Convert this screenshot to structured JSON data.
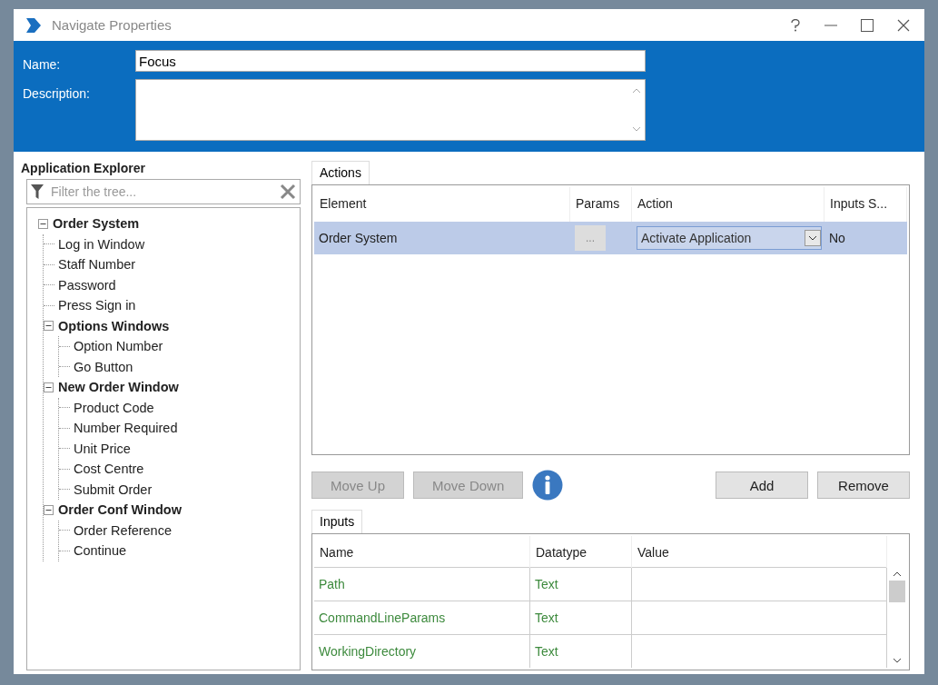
{
  "window": {
    "title": "Navigate Properties"
  },
  "header": {
    "name_label": "Name:",
    "name_value": "Focus",
    "description_label": "Description:"
  },
  "explorer": {
    "title": "Application Explorer",
    "filter_placeholder": "Filter the tree...",
    "tree": [
      {
        "label": "Order System",
        "expanded": true,
        "children": [
          {
            "label": "Log in Window"
          },
          {
            "label": "Staff Number"
          },
          {
            "label": "Password"
          },
          {
            "label": "Press Sign in"
          },
          {
            "label": "Options Windows",
            "expanded": true,
            "children": [
              {
                "label": "Option Number"
              },
              {
                "label": "Go Button"
              }
            ]
          },
          {
            "label": "New Order Window",
            "expanded": true,
            "children": [
              {
                "label": "Product Code"
              },
              {
                "label": "Number Required"
              },
              {
                "label": "Unit Price"
              },
              {
                "label": "Cost Centre"
              },
              {
                "label": "Submit Order"
              }
            ]
          },
          {
            "label": "Order Conf Window",
            "expanded": true,
            "children": [
              {
                "label": "Order Reference"
              },
              {
                "label": "Continue"
              }
            ]
          }
        ]
      }
    ]
  },
  "actions": {
    "tab": "Actions",
    "columns": [
      "Element",
      "Params",
      "Action",
      "Inputs S..."
    ],
    "rows": [
      {
        "element": "Order System",
        "params": "...",
        "action": "Activate Application",
        "inputs": "No",
        "selected": true
      }
    ]
  },
  "buttons": [
    {
      "label": "Move Up",
      "disabled": true
    },
    {
      "label": "Move Down",
      "disabled": true
    },
    {
      "label": "Add",
      "disabled": false
    },
    {
      "label": "Remove",
      "disabled": false
    }
  ],
  "inputs": {
    "tab": "Inputs",
    "columns": [
      "Name",
      "Datatype",
      "Value"
    ],
    "rows": [
      {
        "name": "Path",
        "datatype": "Text"
      },
      {
        "name": "CommandLineParams",
        "datatype": "Text"
      },
      {
        "name": "WorkingDirectory",
        "datatype": "Text"
      }
    ]
  }
}
